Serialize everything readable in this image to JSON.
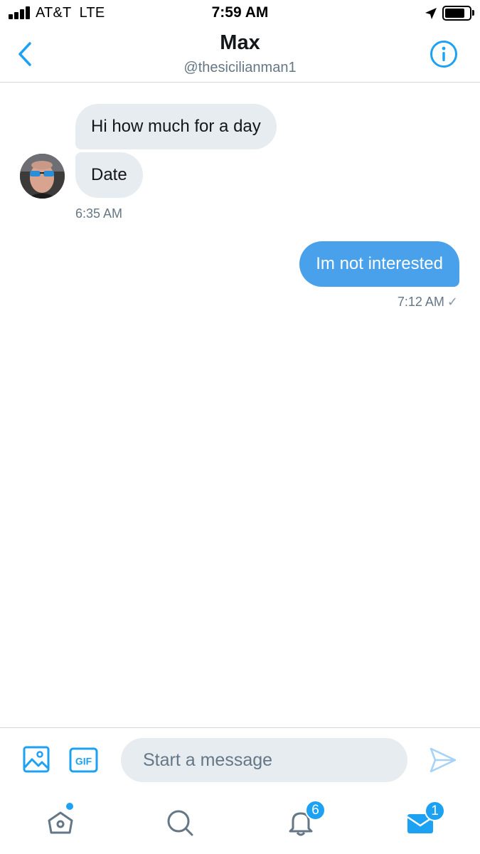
{
  "status_bar": {
    "carrier": "AT&T  LTE",
    "time": "7:59 AM",
    "signal_icon": "signal-bars-icon",
    "location_icon": "location-arrow-icon",
    "battery_icon": "battery-icon"
  },
  "header": {
    "name": "Max",
    "handle": "@thesicilianman1",
    "back_icon": "chevron-left-icon",
    "info_icon": "info-icon"
  },
  "messages": {
    "incoming": [
      {
        "text": "Hi how much for a day"
      },
      {
        "text": "Date"
      }
    ],
    "incoming_time": "6:35 AM",
    "outgoing": [
      {
        "text": "Im not interested"
      }
    ],
    "outgoing_time": "7:12 AM",
    "outgoing_status": "✓"
  },
  "composer": {
    "placeholder": "Start a message",
    "media_icon": "image-icon",
    "gif_label": "GIF",
    "send_icon": "send-icon"
  },
  "tabbar": {
    "notifications_badge": "6",
    "messages_badge": "1",
    "icons": [
      "home-icon",
      "search-icon",
      "bell-icon",
      "mail-icon"
    ]
  },
  "colors": {
    "accent": "#1da1f2",
    "outgoing_bubble": "#4aa1eb",
    "incoming_bubble": "#e6ecf0",
    "secondary_text": "#657786"
  }
}
